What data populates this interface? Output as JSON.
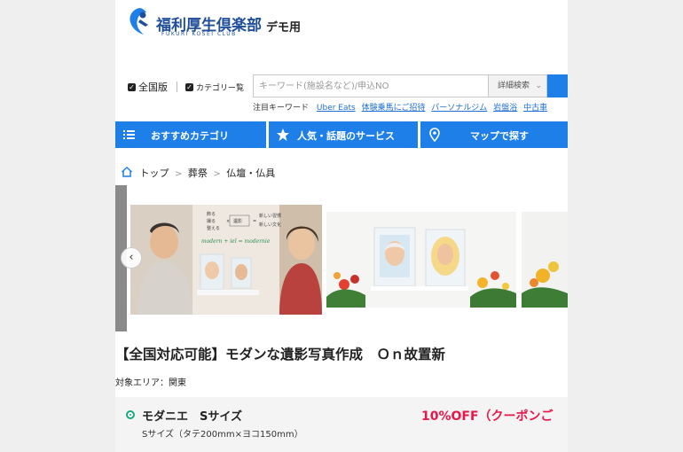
{
  "header": {
    "logo_title": "福利厚生倶楽部",
    "logo_subtitle": "FUKURI KOSEI CLUB",
    "demo_label": "デモ用"
  },
  "search": {
    "check_nationwide": "全国版",
    "check_category": "カテゴリー覧",
    "placeholder": "キーワード(施設名など)/申込NO",
    "detail_label": "詳細検索",
    "keywords_label": "注目キーワード",
    "keywords": [
      "Uber Eats",
      "体験乗馬にご招待",
      "パーソナルジム",
      "岩盤浴",
      "中古車"
    ]
  },
  "nav": {
    "items": [
      {
        "label": "おすすめカテゴリ",
        "icon": "list-icon"
      },
      {
        "label": "人気・話題のサービス",
        "icon": "star-icon"
      },
      {
        "label": "マップで探す",
        "icon": "map-pin-icon"
      }
    ]
  },
  "breadcrumb": [
    "トップ",
    "葬祭",
    "仏壇・仏具"
  ],
  "carousel": {
    "slide1_text": {
      "left_lines": [
        "飾る",
        "撮る",
        "整える"
      ],
      "mid": "遺影",
      "right_lines": [
        "新しい習慣",
        "新しい文化"
      ],
      "brand": "modern + ieī = modernie"
    }
  },
  "listing": {
    "title": "【全国対応可能】モダンな遺影写真作成　Ｏｎ故置新",
    "area": "対象エリア：関東"
  },
  "product": {
    "name": "モダニエ　Sサイズ",
    "size": "Sサイズ（タテ200mm×ヨコ150mm）",
    "badge": "10%OFF（クーポンご"
  },
  "colors": {
    "brand_blue": "#1f4f9a",
    "nav_blue": "#1f7fe8",
    "link_blue": "#1f6fd6",
    "discount_red": "#e8164a",
    "bullet_green": "#18a87f"
  }
}
